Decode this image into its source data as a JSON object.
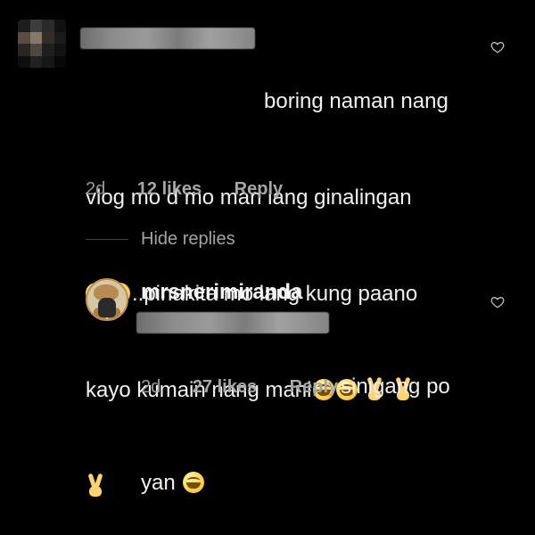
{
  "comment": {
    "avatar_mosaic": [
      "#1d1d1d",
      "#3d3d3d",
      "#2a2a2a",
      "#111111",
      "#5b4b42",
      "#87796a",
      "#332d28",
      "#1b1b1b",
      "#2a2621",
      "#4f4840",
      "#1e1e1e",
      "#121212",
      "#0e0e0e",
      "#202020",
      "#171717",
      "#080808"
    ],
    "text_line_1": "boring naman nang",
    "text_line_2": "vlog mo d mo man lang ginalingan",
    "text_line_3": "..pinakita mo lang kung paano",
    "text_line_4": "kayo kumain nang mani",
    "time": "2d",
    "likes": "12 likes",
    "reply": "Reply",
    "heart_icon": "heart-outline-icon"
  },
  "thread": {
    "hide_replies": "Hide replies"
  },
  "reply_comment": {
    "username": "mrsnerimiranda",
    "text_line_1": "sinigang po",
    "text_line_2": "yan",
    "time": "2d",
    "likes": "27 likes",
    "reply": "Reply",
    "heart_icon": "heart-outline-icon"
  },
  "colors": {
    "background": "#000000",
    "primary_text": "#f2f2f2",
    "secondary_text": "#a4a4a4",
    "avatar_ring": "#bf8e4c"
  }
}
